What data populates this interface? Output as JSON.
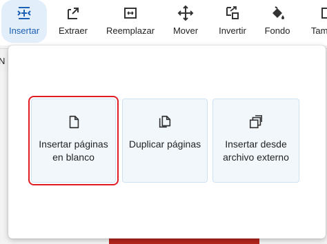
{
  "toolbar": {
    "items": [
      {
        "label": "Insertar",
        "icon": "insert-pages-icon",
        "active": true
      },
      {
        "label": "Extraer",
        "icon": "extract-icon"
      },
      {
        "label": "Reemplazar",
        "icon": "replace-icon"
      },
      {
        "label": "Mover",
        "icon": "move-icon"
      },
      {
        "label": "Invertir",
        "icon": "reverse-icon"
      },
      {
        "label": "Fondo",
        "icon": "fill-bucket-icon"
      },
      {
        "label": "Tamaño",
        "icon": "size-icon"
      }
    ]
  },
  "behind": {
    "strip_text": "N"
  },
  "popup": {
    "options": [
      {
        "label": "Insertar páginas en blanco",
        "icon": "blank-page-icon",
        "selected": true
      },
      {
        "label": "Duplicar páginas",
        "icon": "duplicate-pages-icon"
      },
      {
        "label": "Insertar desde archivo externo",
        "icon": "external-file-icon"
      }
    ]
  },
  "colors": {
    "accent": "#1a5fb4",
    "active_bg": "#e3eefb",
    "card_bg": "#f2f7fc",
    "selection_outline": "#e01b24"
  }
}
